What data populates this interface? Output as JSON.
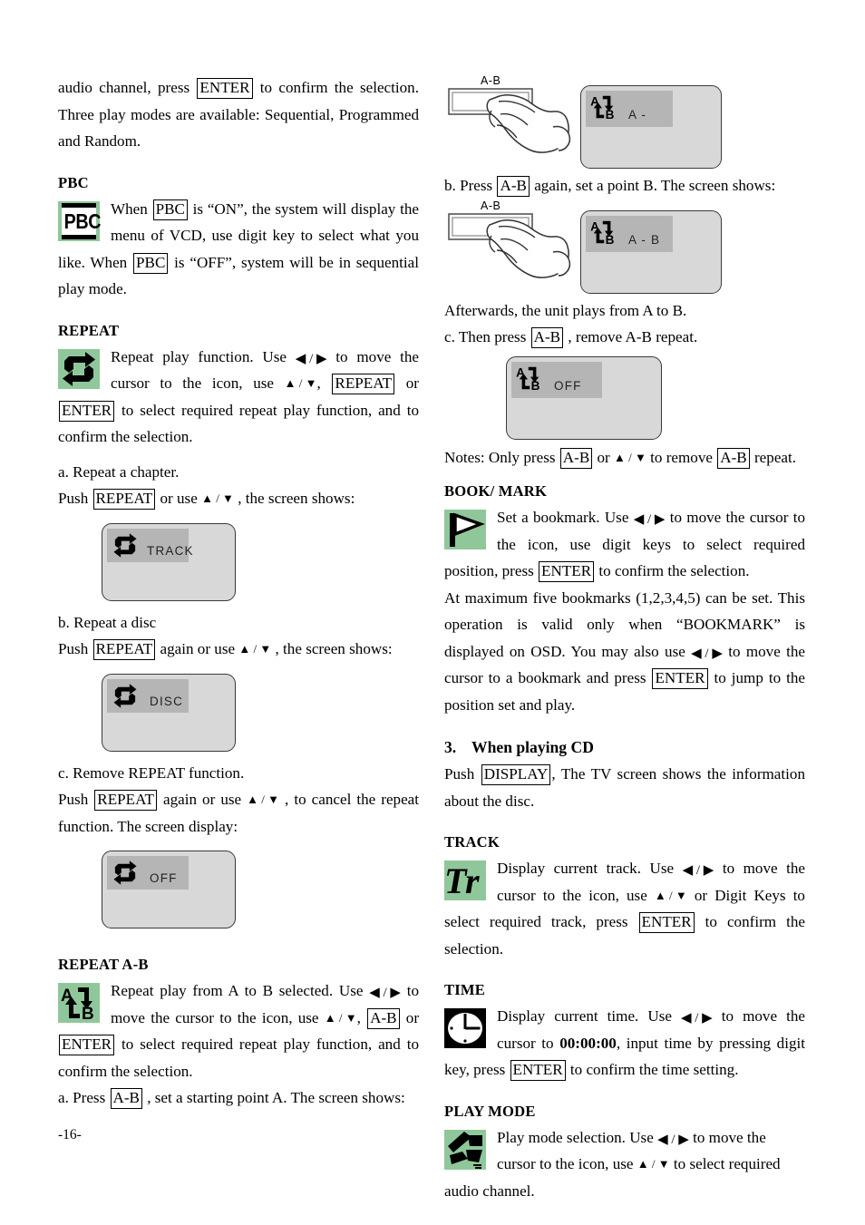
{
  "page": {
    "number": "-16-"
  },
  "colors": {
    "icon_green": "#8fc79a",
    "screen_bg": "#d8d8d8",
    "screen_band": "#b5b5b5"
  },
  "left": {
    "intro": {
      "p1_a": "audio channel, press ",
      "p1_key": "ENTER",
      "p1_b": " to confirm the selection. Three play modes are available: Sequential, Programmed and Random."
    },
    "pbc": {
      "heading": "PBC",
      "icon": "pbc-icon",
      "icon_text": "PBC",
      "t1": "When ",
      "k1": "PBC",
      "t2": " is “ON”, the system will display the menu of VCD, use digit key to select what you like. When ",
      "k2": "PBC",
      "t3": " is “OFF”, system will be in sequential play mode."
    },
    "repeat": {
      "heading": "REPEAT",
      "icon": "repeat-loop-icon",
      "t1": "Repeat play function. Use ",
      "arrow_lr": "◀ / ▶",
      "t2": " to move the cursor to the icon, use ",
      "arrow_ud": "▲ / ▼",
      "t3": ", ",
      "k1": "REPEAT",
      "t4": " or ",
      "k2": "ENTER",
      "t5": " to select required repeat play function, and to confirm the selection.",
      "a_label": "a. Repeat a chapter.",
      "a_push_1": "Push ",
      "a_push_key": "REPEAT",
      "a_push_2": " or use ",
      "a_push_3": " , the screen shows:",
      "screen_a": "TRACK",
      "b_label": "b. Repeat a disc",
      "b_push_1": "Push ",
      "b_push_key": "REPEAT",
      "b_push_2": " again or use ",
      "b_push_3": " , the screen shows:",
      "screen_b": "DISC",
      "c_label": "c. Remove REPEAT function.",
      "c_push_1": "Push ",
      "c_push_key": "REPEAT",
      "c_push_2": " again or use ",
      "c_push_3": " , to cancel the repeat function. The screen display:",
      "screen_c": "OFF"
    },
    "repeat_ab": {
      "heading": "REPEAT A-B",
      "icon": "repeat-ab-icon",
      "icon_a": "A",
      "icon_b": "B",
      "t1": "Repeat play from A to B selected. Use ",
      "t2": " to move the cursor to the icon, use ",
      "t3": ", ",
      "k1": "A-B",
      "t4": " or ",
      "k2": "ENTER",
      "t5": " to select required repeat play function, and to confirm the selection.",
      "a_1": "a. Press ",
      "a_key": "A-B",
      "a_2": " , set a starting point A. The screen shows:"
    }
  },
  "right": {
    "step_a": {
      "button_label": "A-B",
      "screen_text": "A -"
    },
    "step_b": {
      "line_1": "b. Press ",
      "line_key": "A-B",
      "line_2": " again, set a point B. The screen shows:",
      "button_label": "A-B",
      "screen_text": "A - B"
    },
    "after": "Afterwards, the unit plays from A to B.",
    "step_c": {
      "line_1": "c. Then press ",
      "line_key": "A-B",
      "line_2": " , remove A-B repeat.",
      "screen_text": "OFF"
    },
    "notes": {
      "t1": "Notes: Only press ",
      "k1": "A-B",
      "t2": " or ",
      "arrow_ud": "▲ / ▼",
      "t3": " to remove ",
      "k2": "A-B",
      "t4": " repeat."
    },
    "bookmark": {
      "heading": "BOOK/ MARK",
      "icon": "bookmark-flag-icon",
      "t1": "Set a bookmark. Use ",
      "arrow_lr": "◀ / ▶",
      "t2": " to move the cursor to the icon, use digit keys to select required position, press ",
      "k1": "ENTER",
      "t3": " to confirm the selection.",
      "t4": "At maximum five bookmarks (1,2,3,4,5) can be set. This operation is valid only when “BOOKMARK” is displayed on OSD. You may also use ",
      "t5": " to move the cursor to a bookmark and press ",
      "k2": "ENTER",
      "t6": " to jump to the position set and play."
    },
    "cd": {
      "num": "3.",
      "heading": "When playing CD",
      "t1": "Push ",
      "k1": "DISPLAY",
      "t2": ", The TV screen shows the information about the disc."
    },
    "track": {
      "heading": "TRACK",
      "icon": "track-tr-icon",
      "icon_text": "Tr",
      "t1": "Display current track. Use ",
      "arrow_lr": "◀ / ▶",
      "t2": " to move the cursor to the icon, use ",
      "arrow_ud": "▲ / ▼",
      "t3": " or Digit Keys to select required track, press ",
      "k1": "ENTER",
      "t4": " to confirm the selection."
    },
    "time": {
      "heading": "TIME",
      "icon": "clock-icon",
      "t1": "Display current time. Use ",
      "arrow_lr": "◀ / ▶",
      "t2": " to move the cursor to ",
      "bold_time": "00:00:00",
      "t3": ", input time by pressing digit key, press ",
      "k1": "ENTER",
      "t4": " to confirm the time setting."
    },
    "playmode": {
      "heading": "PLAY MODE",
      "icon": "play-mode-shuffle-icon",
      "t1": "Play mode selection. Use ",
      "arrow_lr": "◀ / ▶",
      "t2": " to move the cursor to the icon, use ",
      "arrow_ud": "▲ / ▼",
      "t3": " to select required audio channel."
    }
  }
}
